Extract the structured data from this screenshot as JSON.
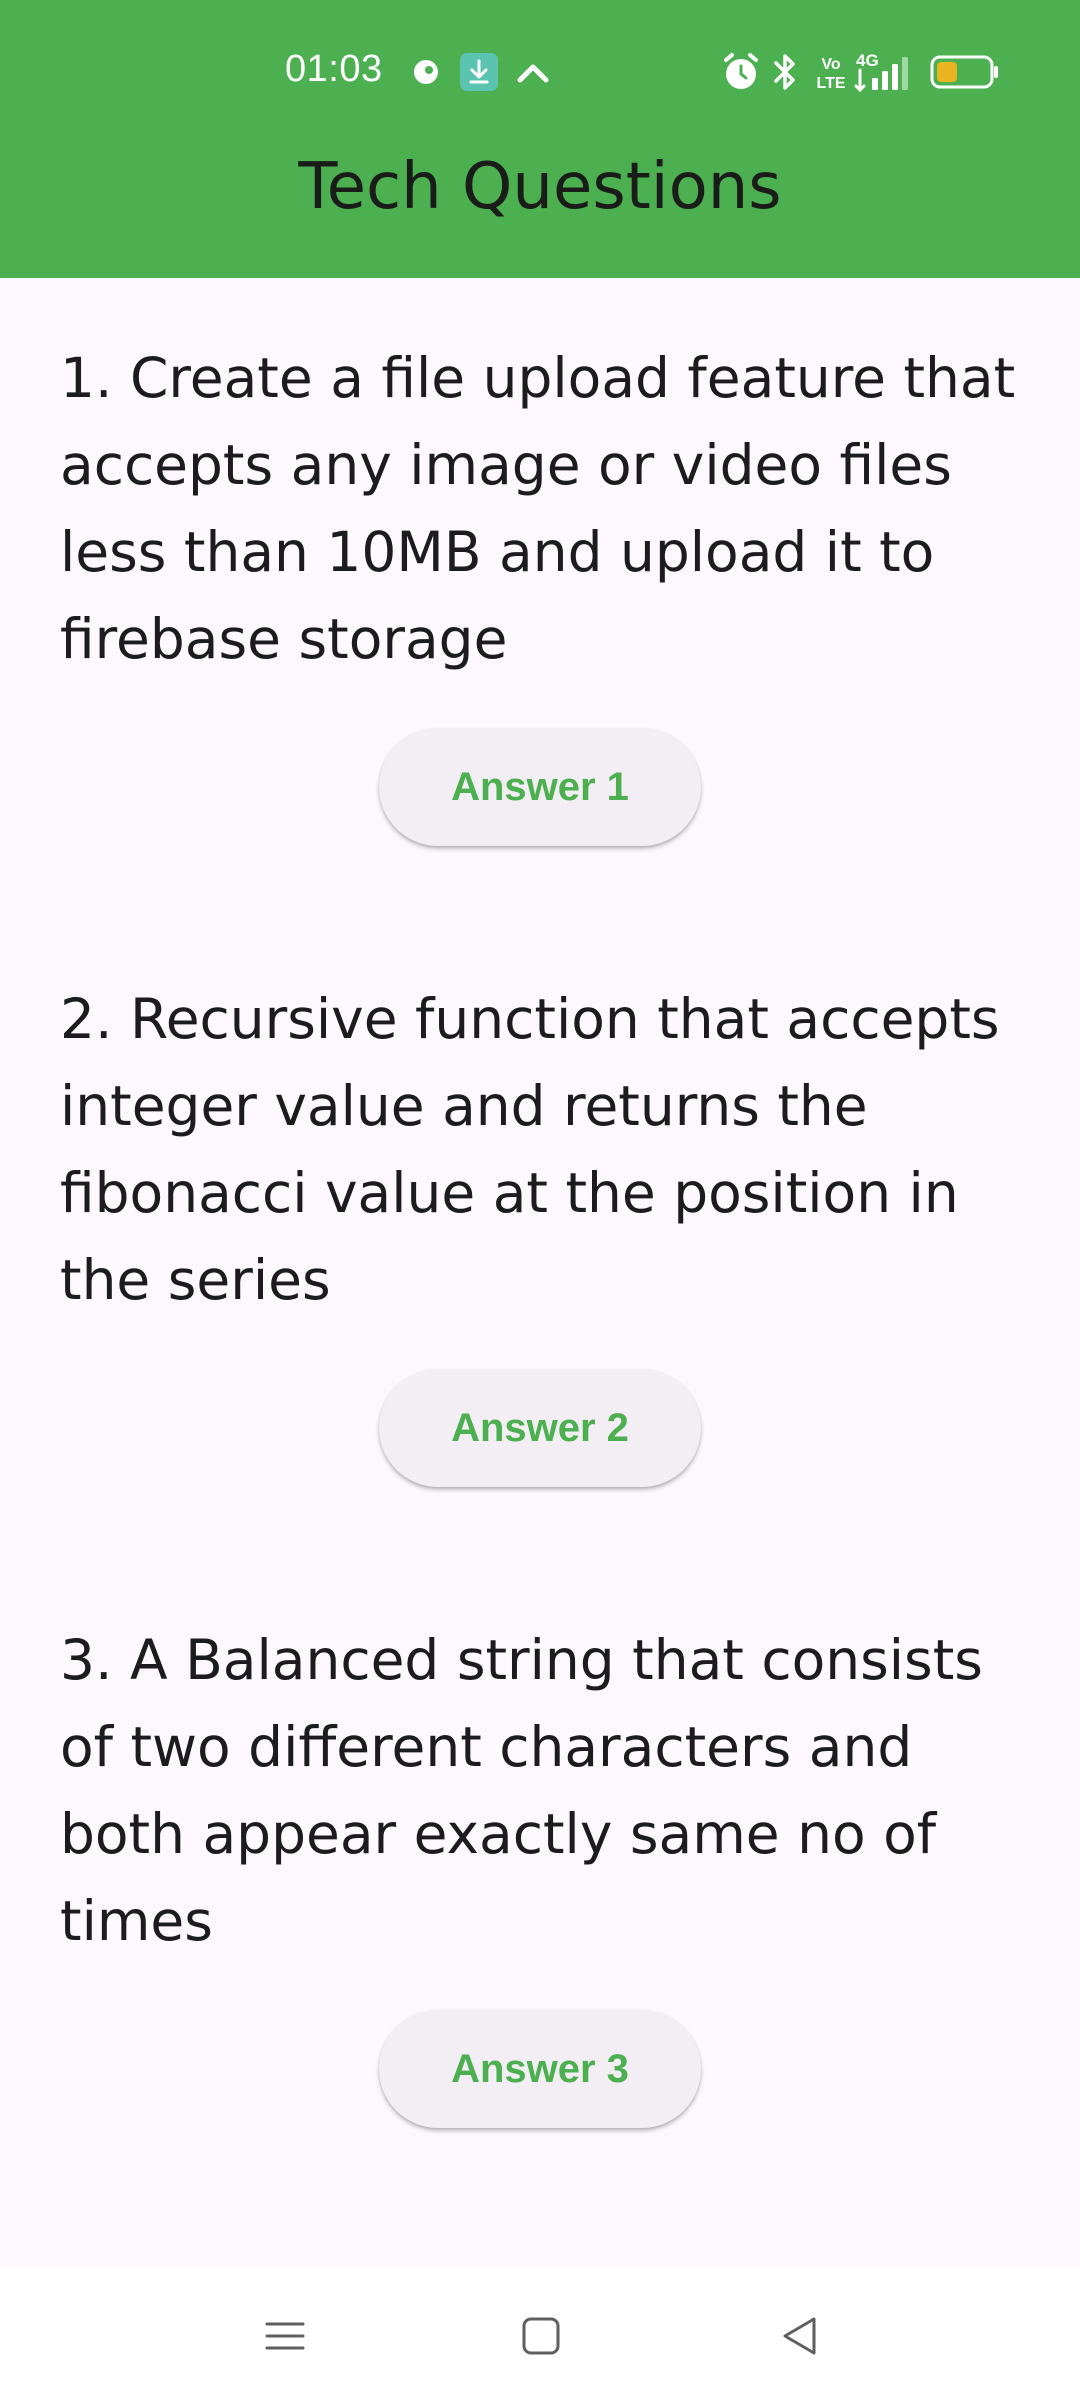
{
  "status_bar": {
    "time": "01:03",
    "icons": [
      "notification-dot-icon",
      "download-icon",
      "chevron-up-icon",
      "alarm-icon",
      "bluetooth-icon",
      "volte-icon",
      "signal-4g-icon",
      "battery-icon"
    ],
    "volte_label": "Vo LTE",
    "network_label": "4G",
    "battery_level": 0.4
  },
  "app_bar": {
    "title": "Tech Questions",
    "background_color": "#4caf50"
  },
  "questions": [
    {
      "text": "1. Create a file upload feature that accepts any image or video files less than 10MB and upload it to firebase storage",
      "button_label": "Answer 1"
    },
    {
      "text": "2. Recursive function that accepts integer value and returns the fibonacci value at the position in the series",
      "button_label": "Answer 2"
    },
    {
      "text": "3. A Balanced string that consists of two different characters and both appear exactly same no of times",
      "button_label": "Answer 3"
    }
  ],
  "nav_bar": {
    "icons": [
      "menu-icon",
      "home-square-icon",
      "back-triangle-icon"
    ]
  },
  "colors": {
    "accent": "#4caf50",
    "background": "#fdf8fc",
    "button_background": "#f3eef4",
    "text": "#1c1b1f"
  }
}
